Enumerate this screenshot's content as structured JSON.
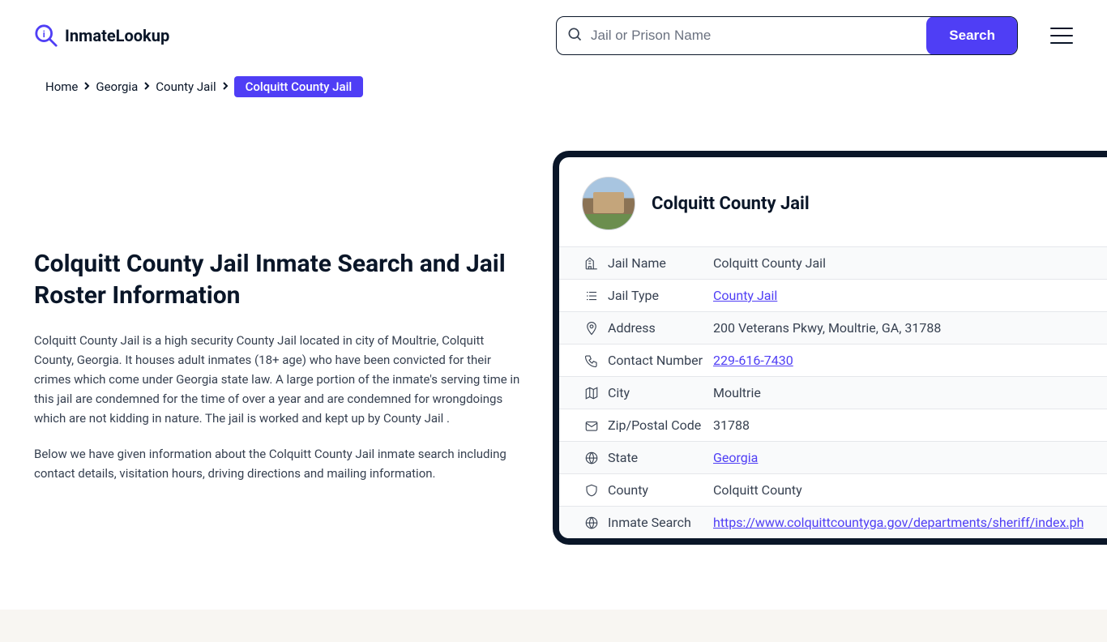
{
  "header": {
    "logo_text": "InmateLookup",
    "search_placeholder": "Jail or Prison Name",
    "search_button": "Search"
  },
  "breadcrumb": {
    "items": [
      "Home",
      "Georgia",
      "County Jail"
    ],
    "current": "Colquitt County Jail"
  },
  "page": {
    "title": "Colquitt County Jail Inmate Search and Jail Roster Information",
    "description_1": "Colquitt County Jail is a high security County Jail located in city of Moultrie, Colquitt County, Georgia. It houses adult inmates (18+ age) who have been convicted for their crimes which come under Georgia state law. A large portion of the inmate's serving time in this jail are condemned for the time of over a year and are condemned for wrongdoings which are not kidding in nature. The jail is worked and kept up by County Jail .",
    "description_2": "Below we have given information about the Colquitt County Jail inmate search including contact details, visitation hours, driving directions and mailing information."
  },
  "card": {
    "title": "Colquitt County Jail",
    "rows": [
      {
        "icon": "building",
        "label": "Jail Name",
        "value": "Colquitt County Jail",
        "link": false
      },
      {
        "icon": "list",
        "label": "Jail Type",
        "value": "County Jail",
        "link": true
      },
      {
        "icon": "pin",
        "label": "Address",
        "value": "200 Veterans Pkwy, Moultrie, GA, 31788",
        "link": false
      },
      {
        "icon": "phone",
        "label": "Contact Number",
        "value": "229-616-7430",
        "link": true
      },
      {
        "icon": "map",
        "label": "City",
        "value": "Moultrie",
        "link": false
      },
      {
        "icon": "envelope",
        "label": "Zip/Postal Code",
        "value": "31788",
        "link": false
      },
      {
        "icon": "globe",
        "label": "State",
        "value": "Georgia",
        "link": true
      },
      {
        "icon": "shield",
        "label": "County",
        "value": "Colquitt County",
        "link": false
      },
      {
        "icon": "globe2",
        "label": "Inmate Search",
        "value": "https://www.colquittcountyga.gov/departments/sheriff/index.php",
        "link": true
      }
    ]
  }
}
